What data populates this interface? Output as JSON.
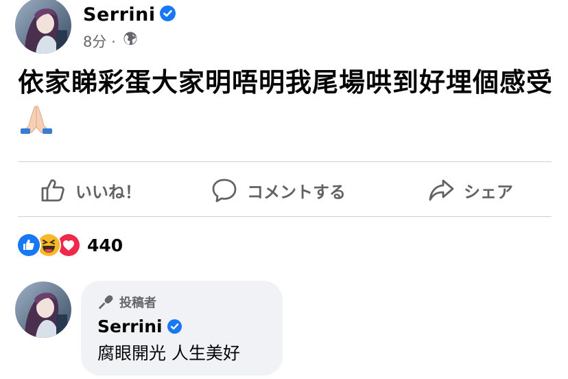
{
  "post": {
    "author": "Serrini",
    "time": "8分",
    "separator": "·",
    "privacy_icon": "globe-icon",
    "text": "依家睇彩蛋大家明唔明我尾場哄到好埋個感受",
    "emoji": "folded-hands",
    "verified_icon": "verified-badge-icon"
  },
  "actions": {
    "like_label": "いいね！",
    "comment_label": "コメントする",
    "share_label": "シェア"
  },
  "reactions": {
    "types": [
      "like",
      "haha",
      "love"
    ],
    "count": "440"
  },
  "comment": {
    "badge": "投稿者",
    "author": "Serrini",
    "text": "腐眼開光 人生美好"
  },
  "colors": {
    "facebook_blue": "#1877f2",
    "secondary_text": "#65676b",
    "bubble_bg": "#f0f2f5",
    "divider": "#cfd1d4",
    "love_red": "#f02849",
    "haha_yellow": "#f7b928"
  }
}
